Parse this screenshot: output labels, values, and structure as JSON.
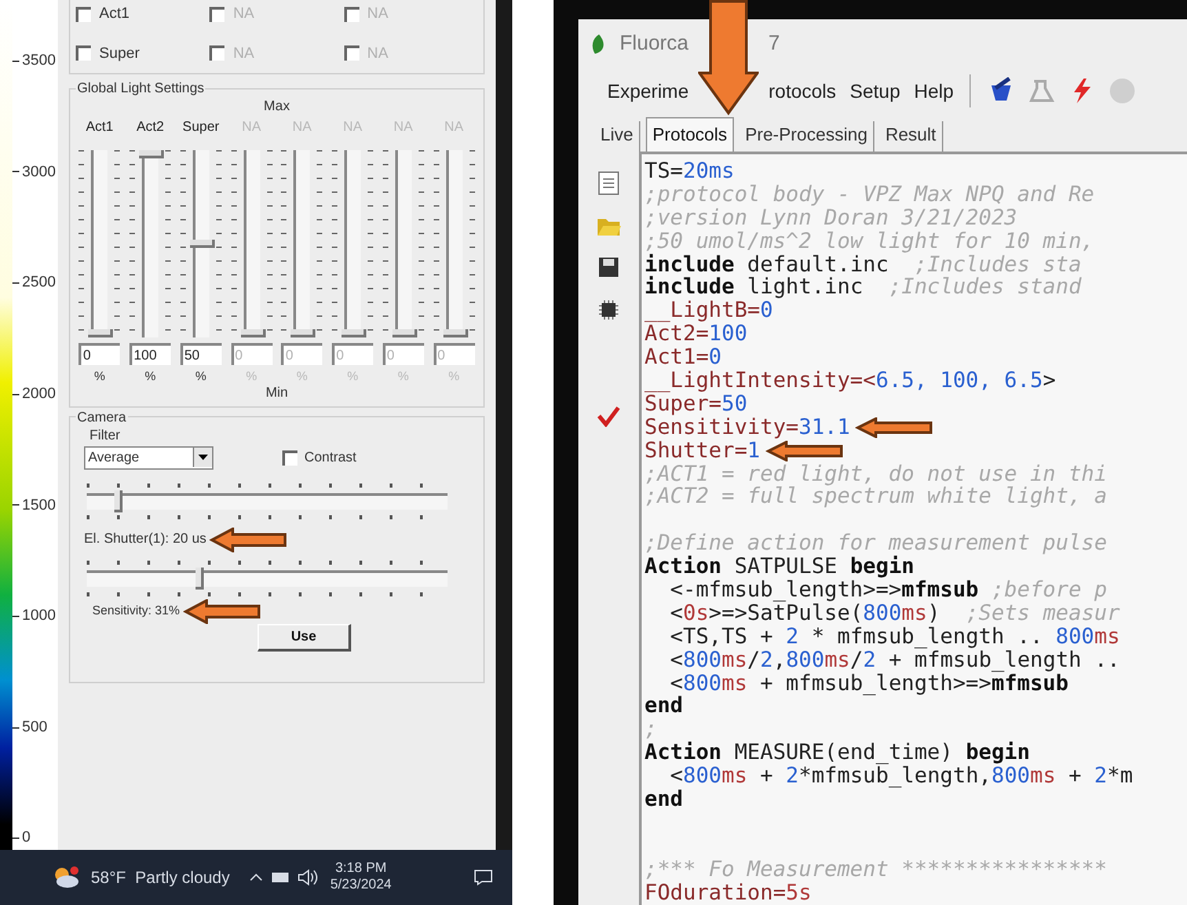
{
  "color_scale": {
    "ticks": [
      "3500",
      "3000",
      "2500",
      "2000",
      "1500",
      "1000",
      "500",
      "0"
    ]
  },
  "left_window": {
    "light_checks": [
      {
        "label": "Act1",
        "checked": false,
        "disabled": false
      },
      {
        "label": "NA",
        "checked": false,
        "disabled": true
      },
      {
        "label": "NA",
        "checked": false,
        "disabled": true
      },
      {
        "label": "Super",
        "checked": false,
        "disabled": false
      },
      {
        "label": "NA",
        "checked": false,
        "disabled": true
      },
      {
        "label": "NA",
        "checked": false,
        "disabled": true
      }
    ],
    "global_light_settings": {
      "title": "Global Light Settings",
      "max_label": "Max",
      "min_label": "Min",
      "channels": [
        {
          "name": "Act1",
          "disabled": false,
          "level": 0,
          "value": "0",
          "unit": "%"
        },
        {
          "name": "Act2",
          "disabled": false,
          "level": 1,
          "value": "100",
          "unit": "%"
        },
        {
          "name": "Super",
          "disabled": false,
          "level": 0.5,
          "value": "50",
          "unit": "%"
        },
        {
          "name": "NA",
          "disabled": true,
          "level": 0,
          "value": "0",
          "unit": "%"
        },
        {
          "name": "NA",
          "disabled": true,
          "level": 0,
          "value": "0",
          "unit": "%"
        },
        {
          "name": "NA",
          "disabled": true,
          "level": 0,
          "value": "0",
          "unit": "%"
        },
        {
          "name": "NA",
          "disabled": true,
          "level": 0,
          "value": "0",
          "unit": "%"
        },
        {
          "name": "NA",
          "disabled": true,
          "level": 0,
          "value": "0",
          "unit": "%"
        }
      ]
    },
    "camera": {
      "title": "Camera",
      "filter_label": "Filter",
      "filter_value": "Average",
      "contrast": {
        "label": "Contrast",
        "checked": false
      },
      "shutter": {
        "level": 0.08,
        "reading": "El. Shutter(1): 20 us"
      },
      "sensitivity": {
        "level": 0.31,
        "reading": "Sensitivity: 31%"
      },
      "use_button": "Use"
    }
  },
  "taskbar": {
    "weather": "58°F  Partly cloudy",
    "time": "3:18 PM",
    "date": "5/23/2024"
  },
  "right_window": {
    "title": "Fluorca",
    "title_tail": "7",
    "menu": [
      "Experime",
      "rotocols",
      "Setup",
      "Help"
    ],
    "tabs": [
      {
        "label": "Live",
        "selected": false
      },
      {
        "label": "Protocols",
        "selected": true
      },
      {
        "label": "Pre-Processing",
        "selected": false
      },
      {
        "label": "Result",
        "selected": false
      }
    ],
    "code_lines": [
      {
        "kind": "code",
        "segments": [
          {
            "kind": "plain",
            "text": "TS="
          },
          {
            "kind": "num",
            "text": "20ms"
          }
        ]
      },
      {
        "kind": "code",
        "segments": [
          {
            "kind": "comment",
            "text": ";protocol body - VPZ Max NPQ and Re"
          }
        ]
      },
      {
        "kind": "code",
        "segments": [
          {
            "kind": "comment",
            "text": ";version Lynn Doran 3/21/2023"
          }
        ]
      },
      {
        "kind": "code",
        "segments": [
          {
            "kind": "comment",
            "text": ";50 umol/ms^2 low light for 10 min,"
          }
        ]
      },
      {
        "kind": "code",
        "segments": [
          {
            "kind": "keyword",
            "text": "include"
          },
          {
            "kind": "plain",
            "text": " default.inc  "
          },
          {
            "kind": "comment",
            "text": ";Includes sta"
          }
        ]
      },
      {
        "kind": "code",
        "segments": [
          {
            "kind": "keyword",
            "text": "include"
          },
          {
            "kind": "plain",
            "text": " light.inc  "
          },
          {
            "kind": "comment",
            "text": ";Includes stand"
          }
        ]
      },
      {
        "kind": "code",
        "segments": [
          {
            "kind": "var",
            "text": "__LightB="
          },
          {
            "kind": "num",
            "text": "0"
          }
        ]
      },
      {
        "kind": "code",
        "segments": [
          {
            "kind": "var",
            "text": "Act2="
          },
          {
            "kind": "num",
            "text": "100"
          }
        ]
      },
      {
        "kind": "code",
        "segments": [
          {
            "kind": "var",
            "text": "Act1="
          },
          {
            "kind": "num",
            "text": "0"
          }
        ]
      },
      {
        "kind": "code",
        "segments": [
          {
            "kind": "var",
            "text": "__LightIntensity=<"
          },
          {
            "kind": "num",
            "text": "6.5, 100, 6.5"
          },
          {
            "kind": "plain",
            "text": ">"
          }
        ]
      },
      {
        "kind": "code",
        "segments": [
          {
            "kind": "var",
            "text": "Super="
          },
          {
            "kind": "num",
            "text": "50"
          }
        ]
      },
      {
        "kind": "code",
        "segments": [
          {
            "kind": "var",
            "text": "Sensitivity="
          },
          {
            "kind": "num",
            "text": "31.1"
          }
        ]
      },
      {
        "kind": "code",
        "segments": [
          {
            "kind": "var",
            "text": "Shutter="
          },
          {
            "kind": "num",
            "text": "1"
          }
        ]
      },
      {
        "kind": "code",
        "segments": [
          {
            "kind": "comment",
            "text": ";ACT1 = red light, do not use in thi"
          }
        ]
      },
      {
        "kind": "code",
        "segments": [
          {
            "kind": "comment",
            "text": ";ACT2 = full spectrum white light, a"
          }
        ]
      },
      {
        "kind": "blank"
      },
      {
        "kind": "code",
        "segments": [
          {
            "kind": "comment",
            "text": ";Define action for measurement pulse"
          }
        ]
      },
      {
        "kind": "code",
        "segments": [
          {
            "kind": "keyword",
            "text": "Action"
          },
          {
            "kind": "plain",
            "text": " SATPULSE "
          },
          {
            "kind": "keyword",
            "text": "begin"
          }
        ]
      },
      {
        "kind": "code",
        "segments": [
          {
            "kind": "plain",
            "text": "  <-mfmsub_length>=>"
          },
          {
            "kind": "keyword",
            "text": "mfmsub"
          },
          {
            "kind": "comment",
            "text": " ;before p"
          }
        ]
      },
      {
        "kind": "code",
        "segments": [
          {
            "kind": "plain",
            "text": "  <"
          },
          {
            "kind": "unit",
            "text": "0s"
          },
          {
            "kind": "plain",
            "text": ">=>SatPulse("
          },
          {
            "kind": "num",
            "text": "800"
          },
          {
            "kind": "unit",
            "text": "ms"
          },
          {
            "kind": "plain",
            "text": ")  "
          },
          {
            "kind": "comment",
            "text": ";Sets measur"
          }
        ]
      },
      {
        "kind": "code",
        "segments": [
          {
            "kind": "plain",
            "text": "  <TS,TS + "
          },
          {
            "kind": "num",
            "text": "2"
          },
          {
            "kind": "plain",
            "text": " * mfmsub_length .. "
          },
          {
            "kind": "num",
            "text": "800"
          },
          {
            "kind": "unit",
            "text": "ms"
          }
        ]
      },
      {
        "kind": "code",
        "segments": [
          {
            "kind": "plain",
            "text": "  <"
          },
          {
            "kind": "num",
            "text": "800"
          },
          {
            "kind": "unit",
            "text": "ms"
          },
          {
            "kind": "plain",
            "text": "/"
          },
          {
            "kind": "num",
            "text": "2"
          },
          {
            "kind": "plain",
            "text": ","
          },
          {
            "kind": "num",
            "text": "800"
          },
          {
            "kind": "unit",
            "text": "ms"
          },
          {
            "kind": "plain",
            "text": "/"
          },
          {
            "kind": "num",
            "text": "2"
          },
          {
            "kind": "plain",
            "text": " + mfmsub_length .."
          }
        ]
      },
      {
        "kind": "code",
        "segments": [
          {
            "kind": "plain",
            "text": "  <"
          },
          {
            "kind": "num",
            "text": "800"
          },
          {
            "kind": "unit",
            "text": "ms"
          },
          {
            "kind": "plain",
            "text": " + mfmsub_length>=>"
          },
          {
            "kind": "keyword",
            "text": "mfmsub"
          }
        ]
      },
      {
        "kind": "code",
        "segments": [
          {
            "kind": "keyword",
            "text": "end"
          }
        ]
      },
      {
        "kind": "code",
        "segments": [
          {
            "kind": "comment",
            "text": ";"
          }
        ]
      },
      {
        "kind": "code",
        "segments": [
          {
            "kind": "keyword",
            "text": "Action"
          },
          {
            "kind": "plain",
            "text": " MEASURE(end_time) "
          },
          {
            "kind": "keyword",
            "text": "begin"
          }
        ]
      },
      {
        "kind": "code",
        "segments": [
          {
            "kind": "plain",
            "text": "  <"
          },
          {
            "kind": "num",
            "text": "800"
          },
          {
            "kind": "unit",
            "text": "ms"
          },
          {
            "kind": "plain",
            "text": " + "
          },
          {
            "kind": "num",
            "text": "2"
          },
          {
            "kind": "plain",
            "text": "*mfmsub_length,"
          },
          {
            "kind": "num",
            "text": "800"
          },
          {
            "kind": "unit",
            "text": "ms"
          },
          {
            "kind": "plain",
            "text": " + "
          },
          {
            "kind": "num",
            "text": "2"
          },
          {
            "kind": "plain",
            "text": "*m"
          }
        ]
      },
      {
        "kind": "code",
        "segments": [
          {
            "kind": "keyword",
            "text": "end"
          }
        ]
      },
      {
        "kind": "blank"
      },
      {
        "kind": "blank"
      },
      {
        "kind": "code",
        "segments": [
          {
            "kind": "comment",
            "text": ";*** Fo Measurement ****************"
          }
        ]
      },
      {
        "kind": "code",
        "segments": [
          {
            "kind": "var",
            "text": "FOduration="
          },
          {
            "kind": "unit",
            "text": "5s"
          }
        ]
      }
    ]
  }
}
